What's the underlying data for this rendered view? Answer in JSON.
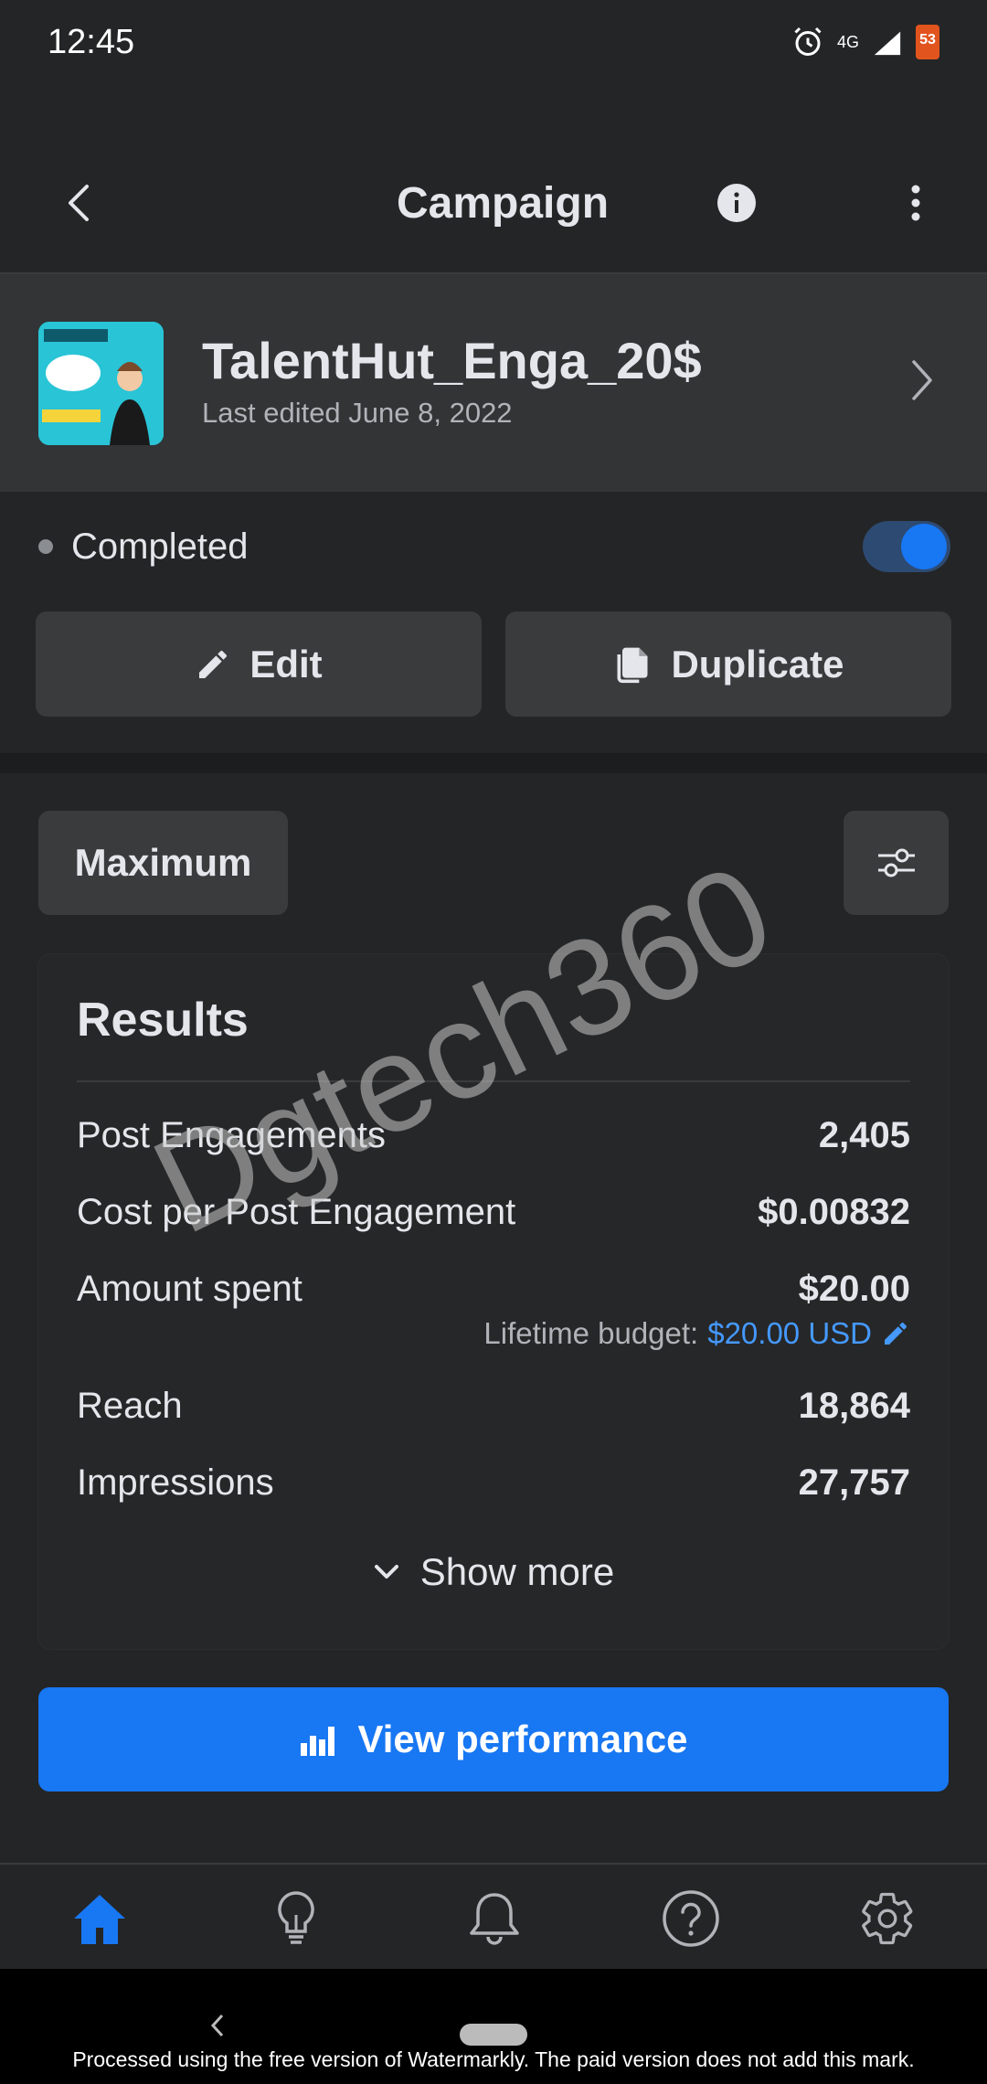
{
  "status_bar": {
    "time": "12:45",
    "network": "4G",
    "battery": "53"
  },
  "header": {
    "title": "Campaign"
  },
  "campaign": {
    "name": "TalentHut_Enga_20$",
    "edited": "Last edited June 8, 2022"
  },
  "status": {
    "label": "Completed",
    "toggle_on": true
  },
  "actions": {
    "edit_label": "Edit",
    "duplicate_label": "Duplicate"
  },
  "filter": {
    "chip_label": "Maximum"
  },
  "results": {
    "title": "Results",
    "metrics": [
      {
        "label": "Post Engagements",
        "value": "2,405"
      },
      {
        "label": "Cost per Post Engagement",
        "value": "$0.00832"
      },
      {
        "label": "Amount spent",
        "value": "$20.00"
      },
      {
        "label": "Reach",
        "value": "18,864"
      },
      {
        "label": "Impressions",
        "value": "27,757"
      }
    ],
    "budget_label": "Lifetime budget:",
    "budget_value": "$20.00 USD",
    "show_more": "Show more"
  },
  "view_performance": "View performance",
  "watermark": "Dgtech360",
  "footer_note": "Processed using the free version of Watermarkly. The paid version does not add this mark.",
  "colors": {
    "accent": "#1877f2",
    "background": "#242526",
    "card": "#323436"
  }
}
